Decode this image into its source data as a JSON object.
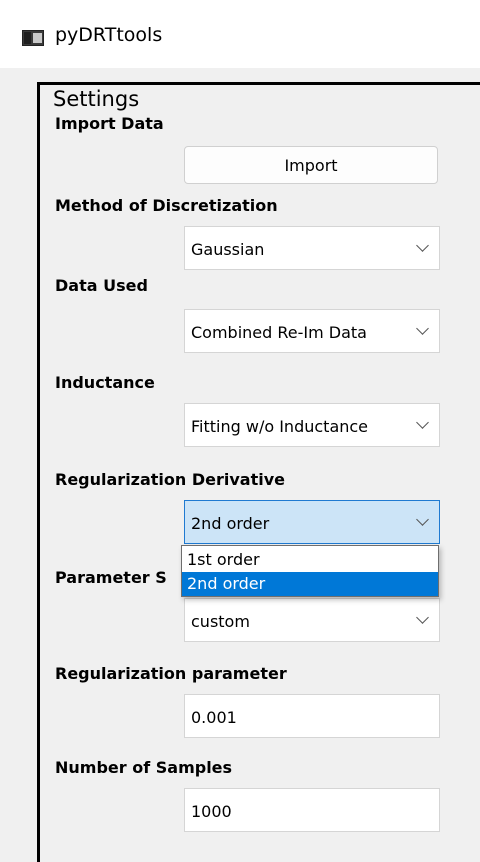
{
  "window": {
    "title": "pyDRTtools",
    "icon": "app-window-icon"
  },
  "settings": {
    "group_title": "Settings",
    "import_data": {
      "label": "Import Data",
      "button_label": "Import"
    },
    "method_of_discretization": {
      "label": "Method of Discretization",
      "value": "Gaussian"
    },
    "data_used": {
      "label": "Data Used",
      "value": "Combined Re-Im Data"
    },
    "inductance": {
      "label": "Inductance",
      "value": "Fitting w/o Inductance"
    },
    "regularization_derivative": {
      "label": "Regularization Derivative",
      "value": "2nd order",
      "options": [
        "1st order",
        "2nd order"
      ],
      "highlighted_option": "2nd order",
      "open": true
    },
    "parameter_selection": {
      "label": "Parameter S",
      "value": "custom"
    },
    "regularization_parameter": {
      "label": "Regularization parameter",
      "value": "0.001"
    },
    "number_of_samples": {
      "label": "Number of Samples",
      "value": "1000"
    }
  },
  "colors": {
    "selection": "#0078d7",
    "active_combo_bg": "#cce4f7",
    "active_combo_border": "#1f7ad1",
    "window_bg": "#f0f0f0"
  }
}
